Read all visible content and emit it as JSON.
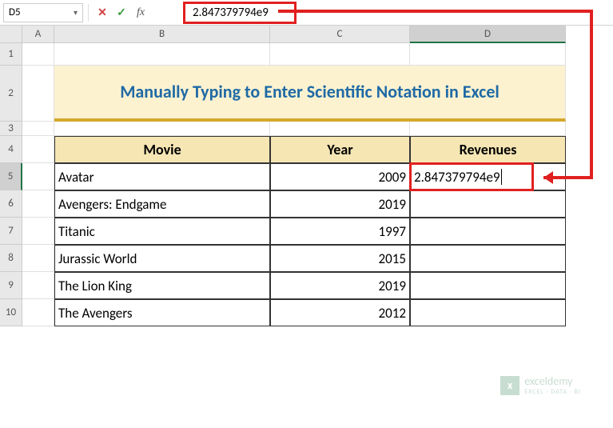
{
  "name_box": "D5",
  "formula_value": "2.847379794e9",
  "columns": [
    "A",
    "B",
    "C",
    "D"
  ],
  "row_numbers": [
    "1",
    "2",
    "3",
    "4",
    "5",
    "6",
    "7",
    "8",
    "9",
    "10"
  ],
  "title": "Manually Typing to Enter Scientific Notation in Excel",
  "headers": {
    "movie": "Movie",
    "year": "Year",
    "revenues": "Revenues"
  },
  "rows": [
    {
      "movie": "Avatar",
      "year": "2009",
      "revenue": "2.847379794e9"
    },
    {
      "movie": "Avengers: Endgame",
      "year": "2019",
      "revenue": ""
    },
    {
      "movie": "Titanic",
      "year": "1997",
      "revenue": ""
    },
    {
      "movie": "Jurassic World",
      "year": "2015",
      "revenue": ""
    },
    {
      "movie": "The Lion King",
      "year": "2019",
      "revenue": ""
    },
    {
      "movie": "The Avengers",
      "year": "2012",
      "revenue": ""
    }
  ],
  "watermark": {
    "brand": "exceldemy",
    "tagline": "EXCEL · DATA · BI"
  }
}
